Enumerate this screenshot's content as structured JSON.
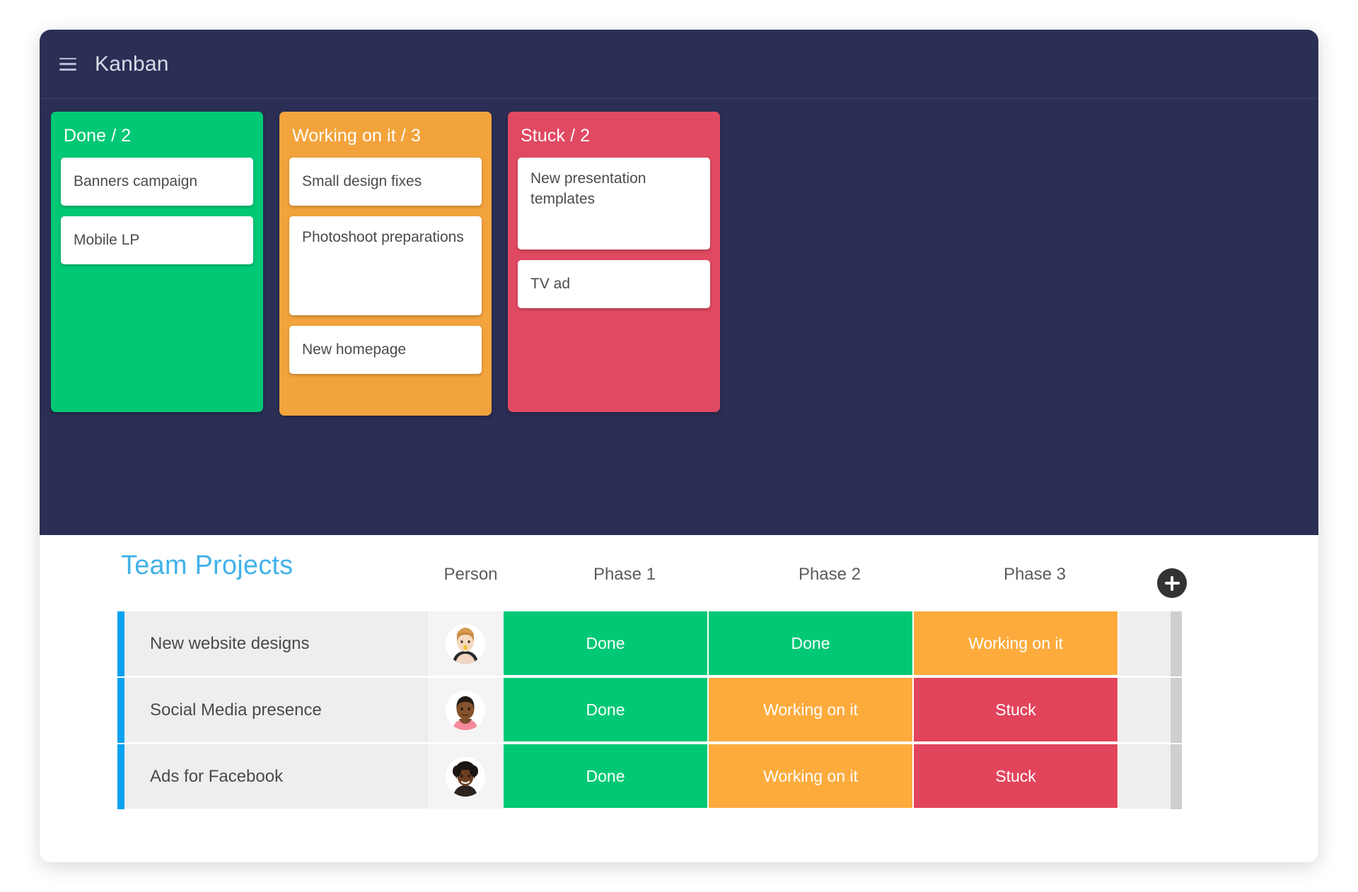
{
  "window": {
    "menu_icon": "hamburger-icon",
    "title": "Kanban"
  },
  "kanban": {
    "columns": [
      {
        "title": "Done / 2",
        "label": "Done",
        "count": 2,
        "color": "#00c875",
        "cards": [
          {
            "title": "Banners campaign"
          },
          {
            "title": "Mobile LP"
          }
        ]
      },
      {
        "title": "Working on it / 3",
        "label": "Working on it",
        "count": 3,
        "color": "#f2a33c",
        "cards": [
          {
            "title": "Small design fixes"
          },
          {
            "title": "Photoshoot preparations"
          },
          {
            "title": "New homepage"
          }
        ]
      },
      {
        "title": "Stuck / 2",
        "label": "Stuck",
        "count": 2,
        "color": "#e04962",
        "cards": [
          {
            "title": "New presentation templates"
          },
          {
            "title": "TV ad"
          }
        ]
      }
    ]
  },
  "board": {
    "title": "Team Projects",
    "title_color": "#42b2e8",
    "add_column_label": "+",
    "headers": {
      "person": "Person",
      "phase1": "Phase 1",
      "phase2": "Phase 2",
      "phase3": "Phase 3"
    },
    "rows": [
      {
        "name": "New website designs",
        "person_alt": "avatar-woman-blonde",
        "phase1": "Done",
        "phase2": "Done",
        "phase3": "Working on it"
      },
      {
        "name": "Social Media presence",
        "person_alt": "avatar-man-short-hair",
        "phase1": "Done",
        "phase2": "Working on it",
        "phase3": "Stuck"
      },
      {
        "name": "Ads for Facebook",
        "person_alt": "avatar-woman-curly-hair",
        "phase1": "Done",
        "phase2": "Working on it",
        "phase3": "Stuck"
      }
    ]
  },
  "colors": {
    "dark_panel": "#2b2f55",
    "done": "#00c875",
    "working": "#fdab3d",
    "stuck": "#e2445c",
    "row_accent": "#0aa2f0"
  }
}
